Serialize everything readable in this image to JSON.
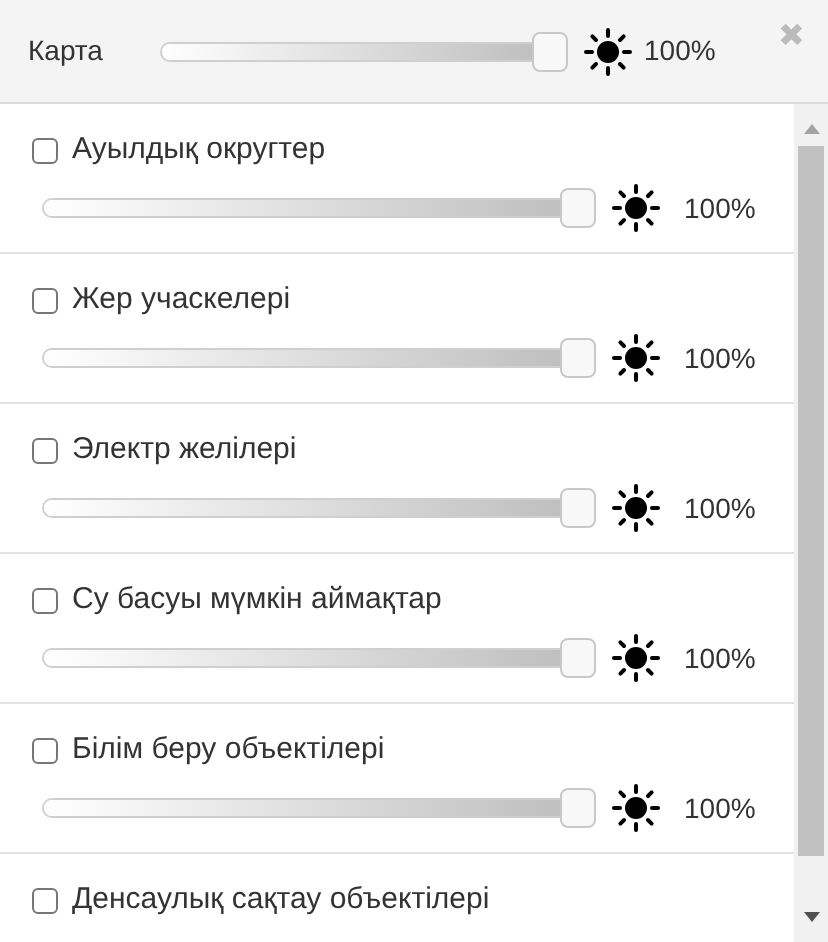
{
  "header": {
    "title": "Карта",
    "level": 1,
    "reading": "100%",
    "close": "✖"
  },
  "layers": [
    {
      "label": "Ауылдық округтер",
      "checked": false,
      "level": 1,
      "reading": "100%"
    },
    {
      "label": "Жер учаскелері",
      "checked": false,
      "level": 1,
      "reading": "100%"
    },
    {
      "label": "Электр желілері",
      "checked": false,
      "level": 1,
      "reading": "100%"
    },
    {
      "label": "Су басуы мүмкін аймақтар",
      "checked": false,
      "level": 1,
      "reading": "100%"
    },
    {
      "label": "Білім беру объектілері",
      "checked": false,
      "level": 1,
      "reading": "100%"
    },
    {
      "label": "Денсаулық сақтау объектілері",
      "checked": false
    }
  ]
}
